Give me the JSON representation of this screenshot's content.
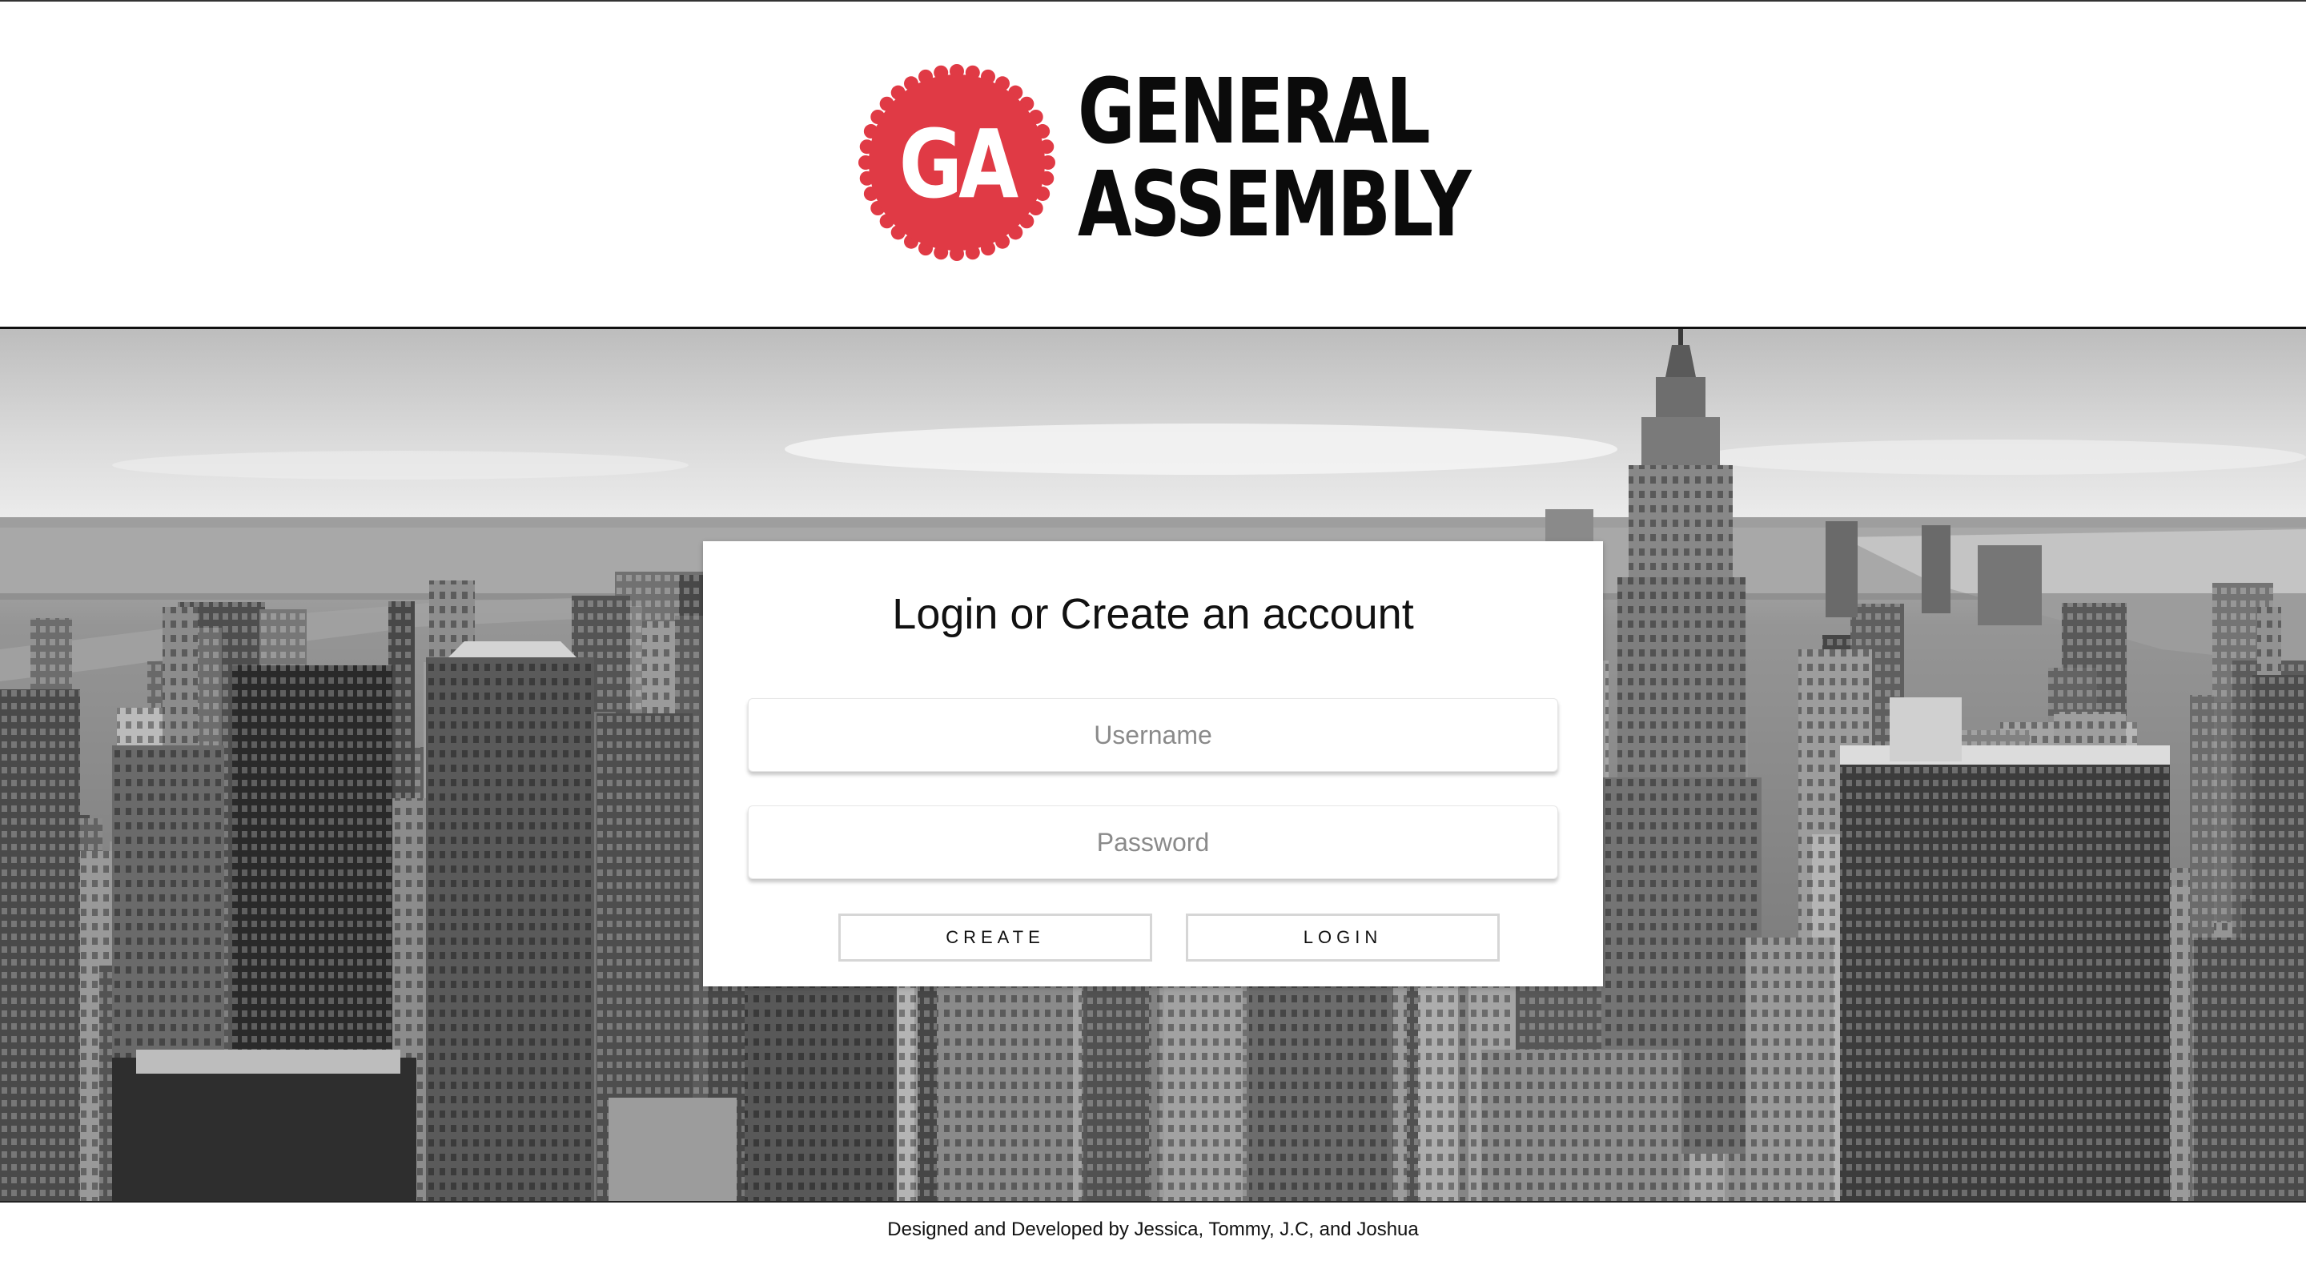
{
  "brand": {
    "logo_badge_text": "GA",
    "wordmark_line1": "GENERAL",
    "wordmark_line2": "ASSEMBLY",
    "badge_color": "#e03a45"
  },
  "hero": {
    "image": "black-and-white New York City skyline with the Empire State Building"
  },
  "login_card": {
    "title": "Login or Create an account",
    "username_placeholder": "Username",
    "password_placeholder": "Password",
    "create_label": "CREATE",
    "login_label": "LOGIN"
  },
  "footer": {
    "credit": "Designed and Developed by Jessica, Tommy, J.C, and Joshua"
  }
}
